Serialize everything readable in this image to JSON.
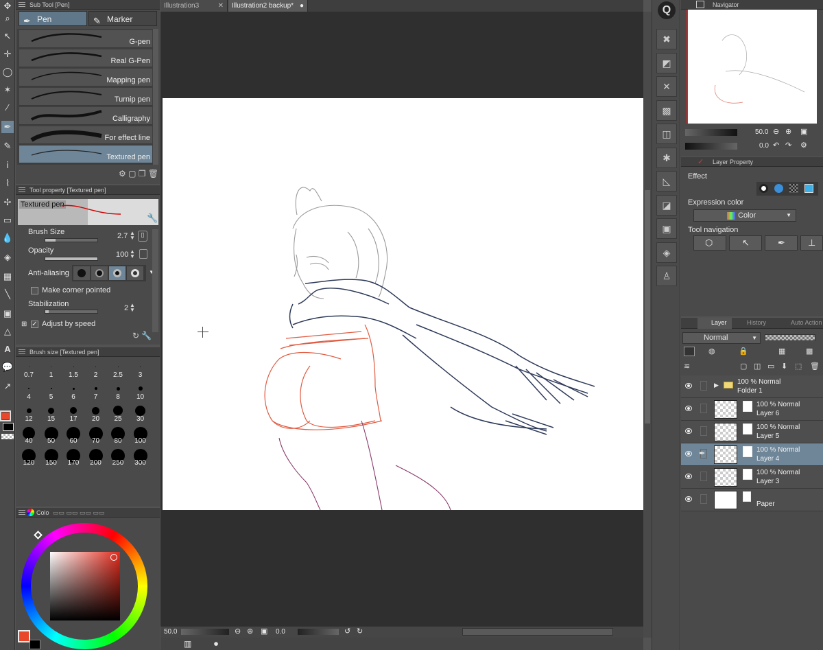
{
  "documents": {
    "tabs": [
      {
        "label": "Illustration3",
        "active": false
      },
      {
        "label": "Illustration2 backup*",
        "active": true
      }
    ]
  },
  "subtool": {
    "header": "Sub Tool [Pen]",
    "groups": [
      "Pen",
      "Marker"
    ],
    "brushes": [
      "G-pen",
      "Real G-Pen",
      "Mapping pen",
      "Turnip pen",
      "Calligraphy",
      "For effect line",
      "Textured pen"
    ],
    "selected": "Textured pen"
  },
  "toolprop": {
    "header": "Tool property [Textured pen]",
    "preview_label": "Textured pen",
    "brush_size_label": "Brush Size",
    "brush_size_value": "2.7",
    "opacity_label": "Opacity",
    "opacity_value": "100",
    "antialias_label": "Anti-aliasing",
    "corner_label": "Make corner pointed",
    "stabilization_label": "Stabilization",
    "stabilization_value": "2",
    "adjust_speed_label": "Adjust by speed"
  },
  "brushsize": {
    "header": "Brush size [Textured pen]",
    "sizes": [
      "0.7",
      "1",
      "1.5",
      "2",
      "2.5",
      "3",
      "4",
      "5",
      "6",
      "7",
      "8",
      "10",
      "12",
      "15",
      "17",
      "20",
      "25",
      "30",
      "40",
      "50",
      "60",
      "70",
      "80",
      "100",
      "120",
      "150",
      "170",
      "200",
      "250",
      "300"
    ]
  },
  "colorpanel": {
    "header": "Colo",
    "main_color": "#e8472b"
  },
  "status": {
    "zoom": "50.0",
    "rotation": "0.0"
  },
  "navigator": {
    "header": "Navigator",
    "zoom": "50.0",
    "rotation": "0.0"
  },
  "layerprop": {
    "header": "Layer Property",
    "effect_label": "Effect",
    "expression_label": "Expression color",
    "expression_value": "Color",
    "toolnav_label": "Tool navigation"
  },
  "layerpanel": {
    "tabs": [
      "Layer",
      "History",
      "Auto Action"
    ],
    "blend_mode": "Normal",
    "layers": [
      {
        "name": "Folder 1",
        "props": "100 % Normal",
        "type": "folder",
        "active": false
      },
      {
        "name": "Layer 6",
        "props": "100 % Normal",
        "type": "raster",
        "active": false
      },
      {
        "name": "Layer 5",
        "props": "100 % Normal",
        "type": "raster",
        "active": false
      },
      {
        "name": "Layer 4",
        "props": "100 % Normal",
        "type": "raster",
        "active": true
      },
      {
        "name": "Layer 3",
        "props": "100 % Normal",
        "type": "raster",
        "active": false
      },
      {
        "name": "Paper",
        "props": "",
        "type": "paper",
        "active": false
      }
    ]
  }
}
